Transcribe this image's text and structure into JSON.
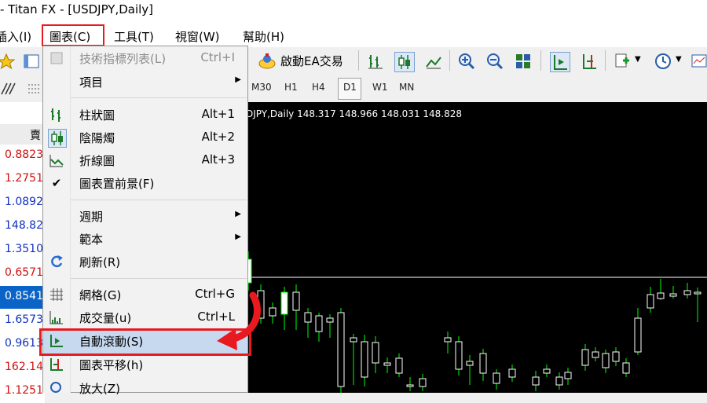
{
  "window": {
    "title": "- Titan FX - [USDJPY,Daily]"
  },
  "menubar": {
    "items": [
      {
        "label": "插入(I)"
      },
      {
        "label": "圖表(C)"
      },
      {
        "label": "工具(T)"
      },
      {
        "label": "視窗(W)"
      },
      {
        "label": "幫助(H)"
      }
    ]
  },
  "toolbar": {
    "ea_label": "啟動EA交易",
    "timeframes": [
      "M30",
      "H1",
      "H4",
      "D1",
      "W1",
      "MN"
    ],
    "active_timeframe": "D1"
  },
  "market_watch": {
    "header": "賣",
    "rows": [
      {
        "value": "0.8823",
        "color": "#d01010"
      },
      {
        "value": "1.2751",
        "color": "#d01010"
      },
      {
        "value": "1.0892",
        "color": "#1030c0"
      },
      {
        "value": "148.82",
        "color": "#1030c0"
      },
      {
        "value": "1.3510",
        "color": "#1030c0"
      },
      {
        "value": "0.6571",
        "color": "#d01010"
      },
      {
        "value": "0.8541",
        "color": "#ffffff",
        "selected": true
      },
      {
        "value": "1.6573",
        "color": "#1030c0"
      },
      {
        "value": "0.9613",
        "color": "#1030c0"
      },
      {
        "value": "162.14",
        "color": "#d01010"
      },
      {
        "value": "1.1251",
        "color": "#d01010"
      }
    ]
  },
  "chart": {
    "info": "DJPY,Daily  148.317 148.966 148.031 148.828"
  },
  "chart_menu": {
    "items": [
      {
        "label": "技術指標列表(L)",
        "shortcut": "Ctrl+I",
        "disabled": true,
        "icon": "indicators-icon"
      },
      {
        "label": "項目",
        "submenu": true
      },
      {
        "label": "柱狀圖",
        "shortcut": "Alt+1",
        "icon": "bar-chart-icon"
      },
      {
        "label": "陰陽燭",
        "shortcut": "Alt+2",
        "icon": "candlestick-icon",
        "checked": true
      },
      {
        "label": "折線圖",
        "shortcut": "Alt+3",
        "icon": "line-chart-icon"
      },
      {
        "label": "圖表置前景(F)",
        "icon": "check-icon"
      },
      {
        "label": "週期",
        "submenu": true
      },
      {
        "label": "範本",
        "submenu": true
      },
      {
        "label": "刷新(R)",
        "icon": "refresh-icon"
      },
      {
        "label": "網格(G)",
        "shortcut": "Ctrl+G",
        "icon": "grid-icon"
      },
      {
        "label": "成交量(u)",
        "shortcut": "Ctrl+L",
        "icon": "volume-icon"
      },
      {
        "label": "自動滾動(S)",
        "icon": "autoscroll-icon",
        "highlighted": true
      },
      {
        "label": "圖表平移(h)",
        "icon": "chart-shift-icon"
      },
      {
        "label": "放大(Z)",
        "icon": "zoom-in-icon"
      }
    ]
  },
  "colors": {
    "highlight_red": "#e8191f",
    "bull": "#ffffff",
    "bear": "#000000",
    "wick": "#00ff00",
    "chart_bg": "#000000"
  }
}
